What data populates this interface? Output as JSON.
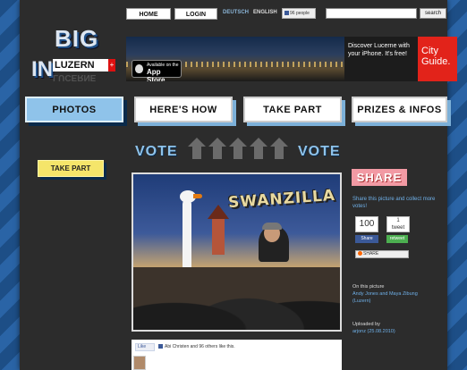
{
  "topnav": {
    "home": "HOME",
    "login": "LOGIN",
    "lang_de": "DEUTSCH",
    "lang_en": "ENGLISH",
    "people": "96 people",
    "search_placeholder": "",
    "search_button": "search"
  },
  "logo": {
    "big": "BIG",
    "in": "IN",
    "luzern": "LUZERN",
    "mirror": "LUCERNE"
  },
  "banner": {
    "store_small": "Available on the",
    "store_big": "App Store",
    "promo": "Discover Lucerne with your iPhone. It's free!",
    "city_guide": "City Guide."
  },
  "tabs": [
    {
      "label": "PHOTOS",
      "active": true
    },
    {
      "label": "HERE'S HOW",
      "active": false
    },
    {
      "label": "TAKE PART",
      "active": false
    },
    {
      "label": "PRIZES & INFOS",
      "active": false
    }
  ],
  "vote": {
    "left": "VOTE",
    "right": "VOTE"
  },
  "left_take_part": "TAKE PART",
  "photo": {
    "caption": "SWANZILLA"
  },
  "share": {
    "title": "SHARE",
    "text": "Share this picture and collect more votes!",
    "count1": "100",
    "count2": "1",
    "count2_label": "tweet",
    "btn1": "Share",
    "btn2": "retweet",
    "addthis": "SHARE"
  },
  "info": {
    "on_picture_label": "On this picture",
    "people": "Andy Jones and Maya Zibung",
    "location": "(Luzern)",
    "uploaded_label": "Uploaded by",
    "uploader": "arjonz (25.08.2010)"
  },
  "fb": {
    "like": "Like",
    "text": "Abi Christen and 96 others like this."
  },
  "colors": {
    "accent_blue": "#8fc3ea",
    "panel": "#2c2c2c",
    "share_pink": "#f29aa4",
    "take_part_yellow": "#f5e56a"
  }
}
